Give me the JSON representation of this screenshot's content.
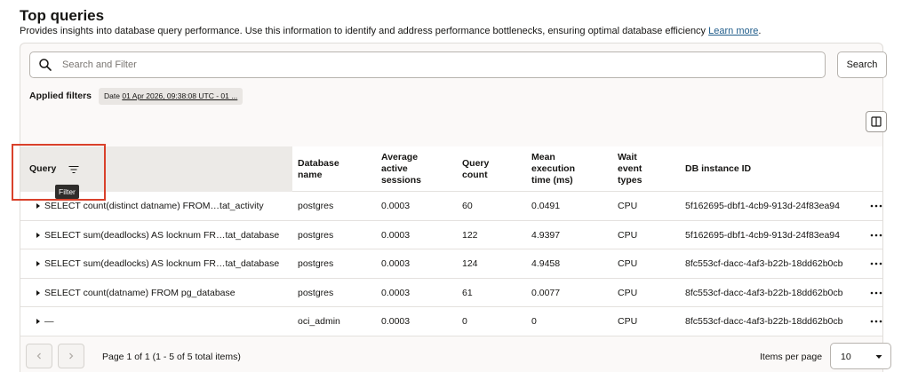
{
  "page": {
    "title": "Top queries",
    "description": "Provides insights into database query performance. Use this information to identify and address performance bottlenecks, ensuring optimal database efficiency",
    "learn_more": "Learn more",
    "description_end": "."
  },
  "search": {
    "placeholder": "Search and Filter",
    "button_label": "Search",
    "icon": "search-icon"
  },
  "filters": {
    "applied_label": "Applied filters",
    "chip_key": "Date",
    "chip_value": "01 Apr 2026, 09:38:08 UTC - 01 ..."
  },
  "columns_button_icon": "columns-icon",
  "table": {
    "headers": {
      "query": "Query",
      "database_name": "Database name",
      "average_active_sessions": "Average active sessions",
      "query_count": "Query count",
      "mean_execution_time": "Mean execution time (ms)",
      "wait_event_types": "Wait event types",
      "db_instance_id": "DB instance ID"
    },
    "filter_tooltip": "Filter",
    "rows": [
      {
        "query": "SELECT count(distinct datname) FROM…tat_activity",
        "database": "postgres",
        "aas": "0.0003",
        "count": "60",
        "met": "0.0491",
        "wait": "CPU",
        "instance": "5f162695-dbf1-4cb9-913d-24f83ea94"
      },
      {
        "query": "SELECT sum(deadlocks) AS locknum FR…tat_database",
        "database": "postgres",
        "aas": "0.0003",
        "count": "122",
        "met": "4.9397",
        "wait": "CPU",
        "instance": "5f162695-dbf1-4cb9-913d-24f83ea94"
      },
      {
        "query": "SELECT sum(deadlocks) AS locknum FR…tat_database",
        "database": "postgres",
        "aas": "0.0003",
        "count": "124",
        "met": "4.9458",
        "wait": "CPU",
        "instance": "8fc553cf-dacc-4af3-b22b-18dd62b0cb"
      },
      {
        "query": "SELECT count(datname) FROM pg_database",
        "database": "postgres",
        "aas": "0.0003",
        "count": "61",
        "met": "0.0077",
        "wait": "CPU",
        "instance": "8fc553cf-dacc-4af3-b22b-18dd62b0cb"
      },
      {
        "query": "—",
        "database": "oci_admin",
        "aas": "0.0003",
        "count": "0",
        "met": "0",
        "wait": "CPU",
        "instance": "8fc553cf-dacc-4af3-b22b-18dd62b0cb"
      }
    ]
  },
  "pagination": {
    "summary": "Page 1 of 1 (1 - 5 of 5 total items)",
    "items_per_page_label": "Items per page",
    "items_per_page_value": "10"
  },
  "colors": {
    "highlight": "#d9412b",
    "link": "#1f5c8a",
    "header_bg": "#eceae7"
  }
}
